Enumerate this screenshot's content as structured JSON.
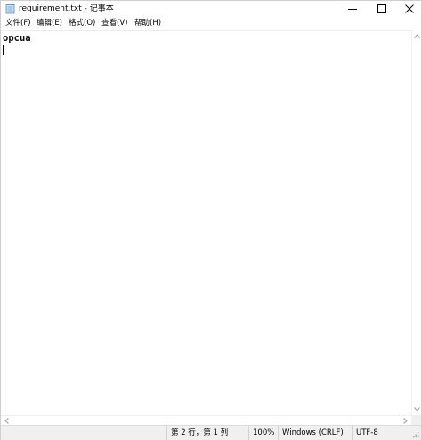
{
  "window": {
    "title": "requirement.txt - 记事本",
    "icon": "notepad-icon",
    "controls": {
      "minimize": "minimize-icon",
      "maximize": "maximize-icon",
      "close": "close-icon"
    }
  },
  "menubar": {
    "items": [
      {
        "label": "文件(F)"
      },
      {
        "label": "编辑(E)"
      },
      {
        "label": "格式(O)"
      },
      {
        "label": "查看(V)"
      },
      {
        "label": "帮助(H)"
      }
    ]
  },
  "editor": {
    "text": "opcua"
  },
  "statusbar": {
    "position": "第 2 行，第 1 列",
    "zoom": "100%",
    "line_ending": "Windows (CRLF)",
    "encoding": "UTF-8"
  },
  "colors": {
    "statusbar_bg": "#f0f0f0",
    "border": "#cfcfcf",
    "text": "#000000"
  }
}
